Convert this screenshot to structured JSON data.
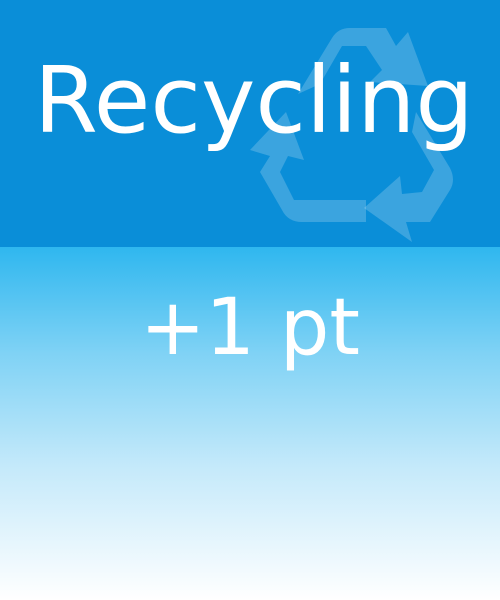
{
  "card": {
    "title": "Recycling",
    "points": "+1 pt"
  },
  "icons": {
    "background_symbol": "recycle-icon"
  },
  "colors": {
    "header_background": "#0a8ed8",
    "body_gradient_top": "#2fb7ef",
    "body_gradient_bottom": "#ffffff",
    "text": "#ffffff"
  }
}
